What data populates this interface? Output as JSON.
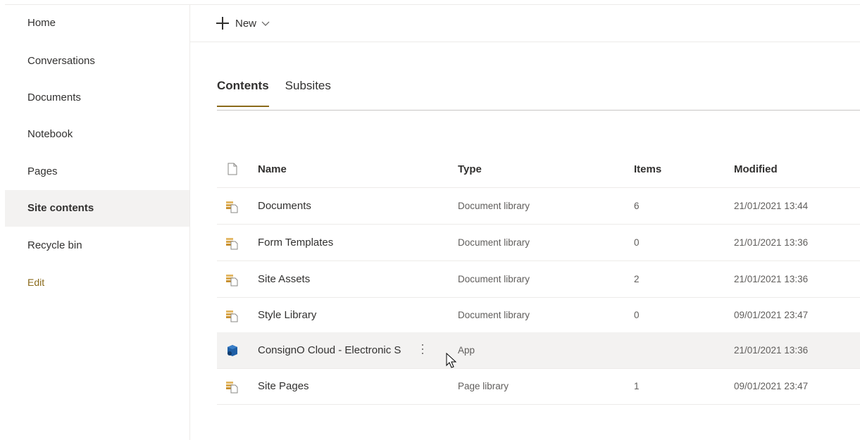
{
  "nav": {
    "items": [
      {
        "label": "Home"
      },
      {
        "label": "Conversations"
      },
      {
        "label": "Documents"
      },
      {
        "label": "Notebook"
      },
      {
        "label": "Pages"
      },
      {
        "label": "Site contents",
        "selected": true
      },
      {
        "label": "Recycle bin"
      }
    ],
    "edit_label": "Edit"
  },
  "commandbar": {
    "new_label": "New",
    "new_icon": "plus-icon",
    "dropdown_icon": "chevron-down-icon"
  },
  "tabs": [
    {
      "label": "Contents",
      "active": true
    },
    {
      "label": "Subsites",
      "active": false
    }
  ],
  "list": {
    "columns": {
      "icon": "file-icon",
      "name": "Name",
      "type": "Type",
      "items": "Items",
      "modified": "Modified"
    },
    "rows": [
      {
        "icon": "document-library-icon",
        "name": "Documents",
        "type": "Document library",
        "items": "6",
        "modified": "21/01/2021 13:44"
      },
      {
        "icon": "document-library-icon",
        "name": "Form Templates",
        "type": "Document library",
        "items": "0",
        "modified": "21/01/2021 13:36"
      },
      {
        "icon": "document-library-icon",
        "name": "Site Assets",
        "type": "Document library",
        "items": "2",
        "modified": "21/01/2021 13:36"
      },
      {
        "icon": "document-library-icon",
        "name": "Style Library",
        "type": "Document library",
        "items": "0",
        "modified": "09/01/2021 23:47"
      },
      {
        "icon": "app-icon",
        "name": "ConsignO Cloud - Electronic S",
        "type": "App",
        "items": "",
        "modified": "21/01/2021 13:36",
        "hover": true
      },
      {
        "icon": "document-library-icon",
        "name": "Site Pages",
        "type": "Page library",
        "items": "1",
        "modified": "09/01/2021 23:47"
      }
    ]
  },
  "colors": {
    "accent": "#8a6a1a",
    "selected_bg": "#f3f2f1",
    "library_icon": "#d9a648",
    "app_icon": "#1f5fa6"
  }
}
